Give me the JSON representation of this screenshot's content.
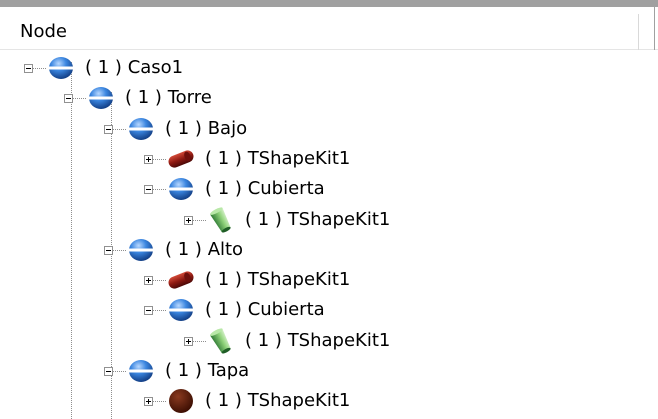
{
  "header": {
    "column_title": "Node"
  },
  "tree": [
    {
      "level": 0,
      "expander": "minus",
      "icon": "separator-node-icon",
      "count": "( 1 )",
      "name": "Caso1"
    },
    {
      "level": 1,
      "expander": "minus",
      "icon": "separator-node-icon",
      "count": "( 1 )",
      "name": "Torre"
    },
    {
      "level": 2,
      "expander": "minus",
      "icon": "separator-node-icon",
      "count": "( 1 )",
      "name": "Bajo"
    },
    {
      "level": 3,
      "expander": "plus",
      "icon": "red-capsule-shape-icon",
      "count": "( 1 )",
      "name": "TShapeKit1"
    },
    {
      "level": 3,
      "expander": "minus",
      "icon": "separator-node-icon",
      "count": "( 1 )",
      "name": "Cubierta"
    },
    {
      "level": 4,
      "expander": "plus",
      "icon": "green-cylinder-shape-icon",
      "count": "( 1 )",
      "name": "TShapeKit1"
    },
    {
      "level": 2,
      "expander": "minus",
      "icon": "separator-node-icon",
      "count": "( 1 )",
      "name": "Alto"
    },
    {
      "level": 3,
      "expander": "plus",
      "icon": "red-capsule-shape-icon",
      "count": "( 1 )",
      "name": "TShapeKit1"
    },
    {
      "level": 3,
      "expander": "minus",
      "icon": "separator-node-icon",
      "count": "( 1 )",
      "name": "Cubierta"
    },
    {
      "level": 4,
      "expander": "plus",
      "icon": "green-cylinder-shape-icon",
      "count": "( 1 )",
      "name": "TShapeKit1"
    },
    {
      "level": 2,
      "expander": "minus",
      "icon": "separator-node-icon",
      "count": "( 1 )",
      "name": "Tapa"
    },
    {
      "level": 3,
      "expander": "plus",
      "icon": "brown-sphere-shape-icon",
      "count": "( 1 )",
      "name": "TShapeKit1"
    }
  ],
  "colors": {
    "separator_blue": "#2f72c4",
    "capsule_red": "#8f1a12",
    "cylinder_green": "#7fbf6a",
    "sphere_brown": "#5a1a08"
  }
}
